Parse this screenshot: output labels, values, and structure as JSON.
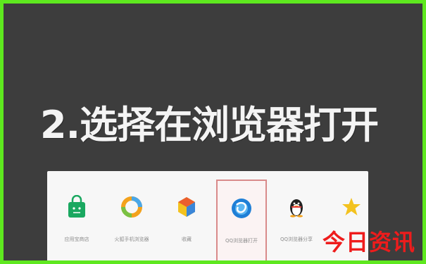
{
  "title": "2.选择在浏览器打开",
  "apps": [
    {
      "label": "应用宝商店",
      "icon": "android-bag-icon",
      "color": "#1aa860",
      "selected": false
    },
    {
      "label": "火狐手机浏览器",
      "icon": "ring-icon",
      "color": "#f3a21c",
      "selected": false
    },
    {
      "label": "收藏",
      "icon": "hexagon-icon",
      "color": "#ea5f2e",
      "selected": false
    },
    {
      "label": "QQ浏览器打开",
      "icon": "browser-icon",
      "color": "#1f7fd6",
      "selected": true
    },
    {
      "label": "QQ浏览器分享",
      "icon": "penguin-icon",
      "color": "#222222",
      "selected": false
    },
    {
      "label": "",
      "icon": "star-icon",
      "color": "#f3c21f",
      "selected": false
    }
  ],
  "watermark": "今日资讯",
  "colors": {
    "frame_border": "#5ee81f",
    "background": "#3d3d3d",
    "title": "#f4f4f4",
    "panel": "#f7f7f7",
    "selected_border": "#d98a8a",
    "watermark": "#ee1c1c"
  }
}
